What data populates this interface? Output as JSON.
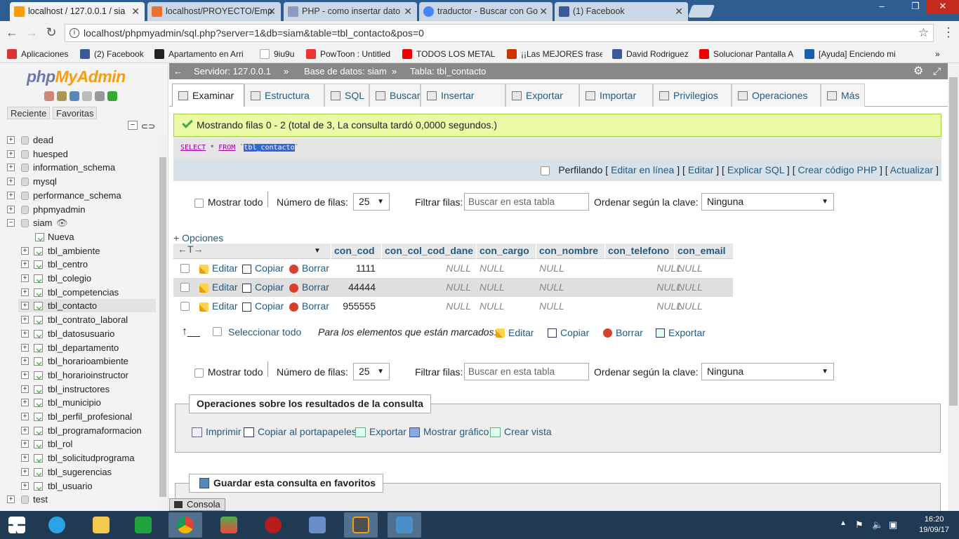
{
  "browser": {
    "tabs": [
      {
        "title": "localhost / 127.0.0.1 / sia",
        "color": "#f89c0e"
      },
      {
        "title": "localhost/PROYECTO/Emp",
        "color": "#e8732c"
      },
      {
        "title": "PHP - como insertar dato",
        "color": "#8a9cc2"
      },
      {
        "title": "traductor - Buscar con Go",
        "color": "#4285f4"
      },
      {
        "title": "(1) Facebook",
        "color": "#3b5998"
      }
    ],
    "window_controls": [
      "–",
      "❐",
      "✕"
    ],
    "address": "localhost/phpmyadmin/sql.php?server=1&db=siam&table=tbl_contacto&pos=0",
    "bookmarks": [
      {
        "label": "Aplicaciones",
        "color": "#d33"
      },
      {
        "label": "(2) Facebook",
        "color": "#3b5998"
      },
      {
        "label": "Apartamento en Arri",
        "color": "#222"
      },
      {
        "label": "9iu9u",
        "color": "#aaa"
      },
      {
        "label": "PowToon : Untitled",
        "color": "#e33"
      },
      {
        "label": "TODOS LOS METAL S",
        "color": "#e00"
      },
      {
        "label": "¡¡Las MEJORES frase",
        "color": "#c30"
      },
      {
        "label": "David Rodriguez",
        "color": "#3b5998"
      },
      {
        "label": "Solucionar Pantalla A",
        "color": "#e00"
      },
      {
        "label": "[Ayuda] Enciendo mi",
        "color": "#1a5fb4"
      }
    ]
  },
  "sidebar": {
    "logo_php": "php",
    "logo_my": "MyAdmin",
    "tab_recent": "Reciente",
    "tab_fav": "Favoritas",
    "databases_top": [
      "dead",
      "huesped",
      "information_schema",
      "mysql",
      "performance_schema",
      "phpmyadmin"
    ],
    "current_db": "siam",
    "new_label": "Nueva",
    "tables": [
      "tbl_ambiente",
      "tbl_centro",
      "tbl_colegio",
      "tbl_competencias",
      "tbl_contacto",
      "tbl_contrato_laboral",
      "tbl_datosusuario",
      "tbl_departamento",
      "tbl_horarioambiente",
      "tbl_horarioinstructor",
      "tbl_instructores",
      "tbl_municipio",
      "tbl_perfil_profesional",
      "tbl_programaformacion",
      "tbl_rol",
      "tbl_solicitudprograma",
      "tbl_sugerencias",
      "tbl_usuario"
    ],
    "databases_bottom": [
      "test"
    ],
    "selected_table": "tbl_contacto"
  },
  "main": {
    "breadcrumb": {
      "server": "Servidor: 127.0.0.1",
      "db": "Base de datos: siam",
      "table": "Tabla: tbl_contacto"
    },
    "tabs": [
      "Examinar",
      "Estructura",
      "SQL",
      "Buscar",
      "Insertar",
      "Exportar",
      "Importar",
      "Privilegios",
      "Operaciones",
      "Más"
    ],
    "success": "Mostrando filas 0 - 2 (total de 3, La consulta tardó 0,0000 segundos.)",
    "sql": {
      "select": "SELECT",
      "star": " * ",
      "from": "FROM",
      "tick": "`",
      "table": "tbl_contacto"
    },
    "profiling": {
      "label": "Perfilando",
      "links": [
        "Editar en línea",
        "Editar",
        "Explicar SQL",
        "Crear código PHP",
        "Actualizar"
      ]
    },
    "controls": {
      "show_all": "Mostrar todo",
      "num_rows": "Número de filas:",
      "num_rows_value": "25",
      "filter": "Filtrar filas:",
      "filter_placeholder": "Buscar en esta tabla",
      "sort": "Ordenar según la clave:",
      "sort_value": "Ninguna"
    },
    "options": "+ Opciones",
    "arrows": "←T→",
    "columns": [
      "con_cod",
      "con_col_cod_dane",
      "con_cargo",
      "con_nombre",
      "con_telefono",
      "con_email"
    ],
    "row_actions": {
      "edit": "Editar",
      "copy": "Copiar",
      "delete": "Borrar"
    },
    "rows": [
      [
        "1111",
        "NULL",
        "NULL",
        "NULL",
        "NULL",
        "NULL"
      ],
      [
        "44444",
        "NULL",
        "NULL",
        "NULL",
        "NULL",
        "NULL"
      ],
      [
        "955555",
        "NULL",
        "NULL",
        "NULL",
        "NULL",
        "NULL"
      ]
    ],
    "bulk": {
      "select_all": "Seleccionar todo",
      "marked": "Para los elementos que están marcados:",
      "edit": "Editar",
      "copy": "Copiar",
      "delete": "Borrar",
      "export": "Exportar"
    },
    "ops": {
      "title": "Operaciones sobre los resultados de la consulta",
      "items": [
        "Imprimir",
        "Copiar al portapapeles",
        "Exportar",
        "Mostrar gráfico",
        "Crear vista"
      ]
    },
    "fav": {
      "title": "Guardar esta consulta en favoritos"
    },
    "console": "Consola"
  },
  "taskbar": {
    "time": "16:20",
    "date": "19/09/17"
  }
}
